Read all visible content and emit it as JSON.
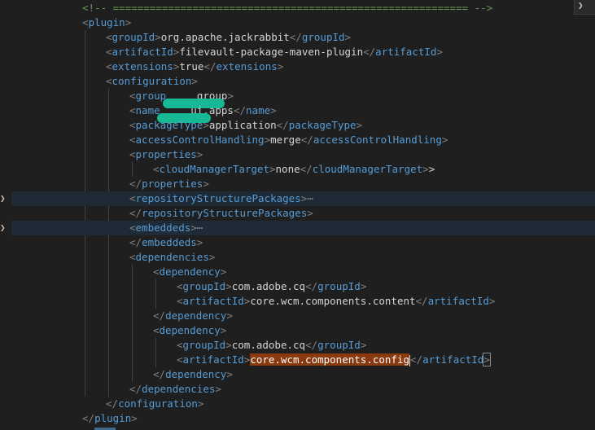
{
  "lines": [
    {
      "indent": 6,
      "segments": [
        [
          "cmt",
          "<!-- ========================================================== -->"
        ]
      ]
    },
    {
      "indent": 6,
      "segments": [
        [
          "br",
          "<"
        ],
        [
          "tag",
          "plugin"
        ],
        [
          "br",
          ">"
        ]
      ]
    },
    {
      "indent": 8,
      "segments": [
        [
          "br",
          "<"
        ],
        [
          "tag",
          "groupId"
        ],
        [
          "br",
          ">"
        ],
        [
          "txt",
          "org.apache.jackrabbit"
        ],
        [
          "br",
          "</"
        ],
        [
          "tag",
          "groupId"
        ],
        [
          "br",
          ">"
        ]
      ]
    },
    {
      "indent": 8,
      "segments": [
        [
          "br",
          "<"
        ],
        [
          "tag",
          "artifactId"
        ],
        [
          "br",
          ">"
        ],
        [
          "txt",
          "filevault-package-maven-plugin"
        ],
        [
          "br",
          "</"
        ],
        [
          "tag",
          "artifactId"
        ],
        [
          "br",
          ">"
        ]
      ]
    },
    {
      "indent": 8,
      "segments": [
        [
          "br",
          "<"
        ],
        [
          "tag",
          "extensions"
        ],
        [
          "br",
          ">"
        ],
        [
          "txt",
          "true"
        ],
        [
          "br",
          "</"
        ],
        [
          "tag",
          "extensions"
        ],
        [
          "br",
          ">"
        ]
      ]
    },
    {
      "indent": 8,
      "segments": [
        [
          "br",
          "<"
        ],
        [
          "tag",
          "configuration"
        ],
        [
          "br",
          ">"
        ]
      ]
    },
    {
      "indent": 10,
      "segments": [
        [
          "br",
          "<"
        ],
        [
          "tag",
          "group"
        ],
        [
          "redact",
          "76"
        ],
        [
          "tag",
          "     "
        ],
        [
          "txt",
          "group"
        ],
        [
          "br",
          ">"
        ]
      ]
    },
    {
      "indent": 10,
      "segments": [
        [
          "br",
          "<"
        ],
        [
          "tag",
          "name"
        ],
        [
          "redact",
          "66"
        ],
        [
          "txt",
          "     ui.apps"
        ],
        [
          "br",
          "</"
        ],
        [
          "tag",
          "name"
        ],
        [
          "br",
          ">"
        ]
      ]
    },
    {
      "indent": 10,
      "segments": [
        [
          "br",
          "<"
        ],
        [
          "tag",
          "packageType"
        ],
        [
          "br",
          ">"
        ],
        [
          "txt",
          "application"
        ],
        [
          "br",
          "</"
        ],
        [
          "tag",
          "packageType"
        ],
        [
          "br",
          ">"
        ]
      ]
    },
    {
      "indent": 10,
      "segments": [
        [
          "br",
          "<"
        ],
        [
          "tag",
          "accessControlHandling"
        ],
        [
          "br",
          ">"
        ],
        [
          "txt",
          "merge"
        ],
        [
          "br",
          "</"
        ],
        [
          "tag",
          "accessControlHandling"
        ],
        [
          "br",
          ">"
        ]
      ]
    },
    {
      "indent": 10,
      "segments": [
        [
          "br",
          "<"
        ],
        [
          "tag",
          "properties"
        ],
        [
          "br",
          ">"
        ]
      ]
    },
    {
      "indent": 12,
      "segments": [
        [
          "br",
          "<"
        ],
        [
          "tag",
          "cloudManagerTarget"
        ],
        [
          "br",
          ">"
        ],
        [
          "txt",
          "none"
        ],
        [
          "br",
          "</"
        ],
        [
          "tag",
          "cloudManagerTarget"
        ],
        [
          "br",
          ">"
        ],
        [
          "txt",
          ">"
        ]
      ]
    },
    {
      "indent": 10,
      "segments": [
        [
          "br",
          "</"
        ],
        [
          "tag",
          "properties"
        ],
        [
          "br",
          ">"
        ]
      ]
    },
    {
      "indent": 10,
      "fold": true,
      "hl": true,
      "segments": [
        [
          "br",
          "<"
        ],
        [
          "tag",
          "repositoryStructurePackages"
        ],
        [
          "br",
          ">"
        ],
        [
          "ellip",
          "⋯"
        ]
      ]
    },
    {
      "indent": 10,
      "segments": [
        [
          "br",
          "</"
        ],
        [
          "tag",
          "repositoryStructurePackages"
        ],
        [
          "br",
          ">"
        ]
      ]
    },
    {
      "indent": 10,
      "fold": true,
      "hl": true,
      "segments": [
        [
          "br",
          "<"
        ],
        [
          "tag",
          "embeddeds"
        ],
        [
          "br",
          ">"
        ],
        [
          "ellip",
          "⋯"
        ]
      ]
    },
    {
      "indent": 10,
      "segments": [
        [
          "br",
          "</"
        ],
        [
          "tag",
          "embeddeds"
        ],
        [
          "br",
          ">"
        ]
      ]
    },
    {
      "indent": 10,
      "segments": [
        [
          "br",
          "<"
        ],
        [
          "tag",
          "dependencies"
        ],
        [
          "br",
          ">"
        ]
      ]
    },
    {
      "indent": 12,
      "segments": [
        [
          "br",
          "<"
        ],
        [
          "tag",
          "dependency"
        ],
        [
          "br",
          ">"
        ]
      ]
    },
    {
      "indent": 14,
      "segments": [
        [
          "br",
          "<"
        ],
        [
          "tag",
          "groupId"
        ],
        [
          "br",
          ">"
        ],
        [
          "txt",
          "com.adobe.cq"
        ],
        [
          "br",
          "</"
        ],
        [
          "tag",
          "groupId"
        ],
        [
          "br",
          ">"
        ]
      ]
    },
    {
      "indent": 14,
      "segments": [
        [
          "br",
          "<"
        ],
        [
          "tag",
          "artifactId"
        ],
        [
          "br",
          ">"
        ],
        [
          "txt",
          "core.wcm.components.content"
        ],
        [
          "br",
          "</"
        ],
        [
          "tag",
          "artifactId"
        ],
        [
          "br",
          ">"
        ]
      ]
    },
    {
      "indent": 12,
      "segments": [
        [
          "br",
          "</"
        ],
        [
          "tag",
          "dependency"
        ],
        [
          "br",
          ">"
        ]
      ]
    },
    {
      "indent": 12,
      "segments": [
        [
          "br",
          "<"
        ],
        [
          "tag",
          "dependency"
        ],
        [
          "br",
          ">"
        ]
      ]
    },
    {
      "indent": 14,
      "segments": [
        [
          "br",
          "<"
        ],
        [
          "tag",
          "groupId"
        ],
        [
          "br",
          ">"
        ],
        [
          "txt",
          "com.adobe.cq"
        ],
        [
          "br",
          "</"
        ],
        [
          "tag",
          "groupId"
        ],
        [
          "br",
          ">"
        ]
      ]
    },
    {
      "indent": 14,
      "segments": [
        [
          "br",
          "<"
        ],
        [
          "tag",
          "artifactId"
        ],
        [
          "br",
          ">"
        ],
        [
          "sel",
          "core.wcm.components.config"
        ],
        [
          "cursor",
          ""
        ],
        [
          "br",
          "</"
        ],
        [
          "tag",
          "artifactId"
        ],
        [
          "boxed",
          ">"
        ]
      ]
    },
    {
      "indent": 12,
      "segments": [
        [
          "br",
          "</"
        ],
        [
          "tag",
          "dependency"
        ],
        [
          "br",
          ">"
        ]
      ]
    },
    {
      "indent": 10,
      "segments": [
        [
          "br",
          "</"
        ],
        [
          "tag",
          "dependencies"
        ],
        [
          "br",
          ">"
        ]
      ]
    },
    {
      "indent": 8,
      "segments": [
        [
          "br",
          "</"
        ],
        [
          "tag",
          "configuration"
        ],
        [
          "br",
          ">"
        ]
      ]
    },
    {
      "indent": 6,
      "segments": [
        [
          "br",
          "</"
        ],
        [
          "tag",
          "plugin"
        ],
        [
          "br",
          ">"
        ]
      ]
    }
  ],
  "corner_widget_icon": "chevron-right-icon",
  "corner_widget_glyph": "❯",
  "fold_glyph": "❯",
  "colors": {
    "background": "#1f1f1f",
    "tag": "#569cd6",
    "bracket": "#808080",
    "text": "#d4d4d4",
    "comment": "#6a9955",
    "selection": "#8a3a0e",
    "redaction": "#17b894",
    "highlight_line": "#1e2a35"
  }
}
